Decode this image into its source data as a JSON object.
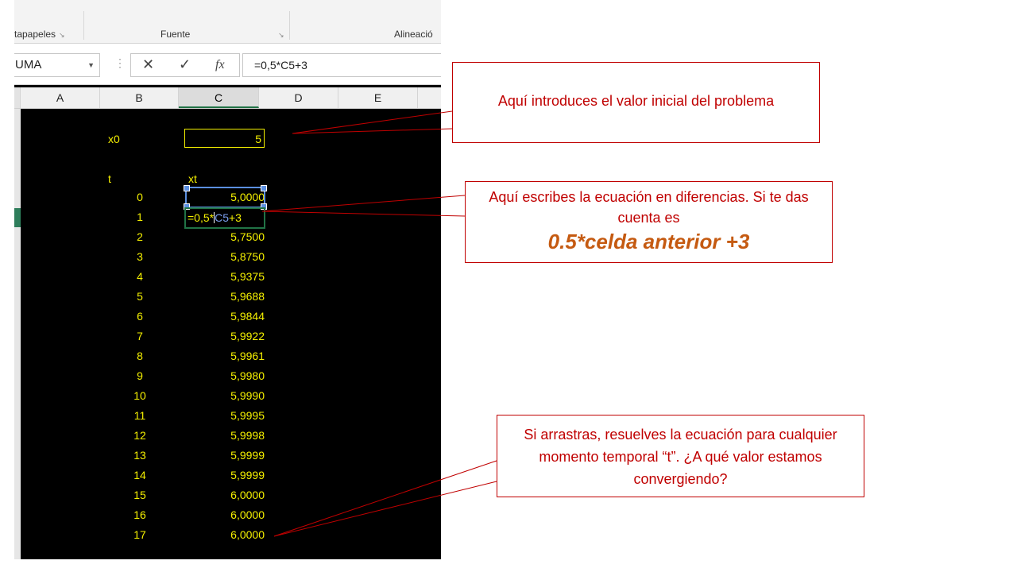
{
  "ribbon": {
    "groups": [
      {
        "label": "tapapeles",
        "launcher": "↘"
      },
      {
        "label": "Fuente",
        "launcher": "↘"
      },
      {
        "label": "Alineació"
      }
    ]
  },
  "formula_bar": {
    "name_box": "UMA",
    "cancel_icon": "✕",
    "enter_icon": "✓",
    "fx_label": "fx",
    "formula": "=0,5*C5+3"
  },
  "columns": [
    "A",
    "B",
    "C",
    "D",
    "E"
  ],
  "sheet": {
    "x0_label": "x0",
    "x0_value": "5",
    "t_header": "t",
    "xt_header": "xt",
    "editing_prefix": "=0,5*",
    "editing_ref": "C5",
    "editing_suffix": "+3",
    "rows": [
      {
        "t": "0",
        "x": "5,0000"
      },
      {
        "t": "1",
        "x": ""
      },
      {
        "t": "2",
        "x": "5,7500"
      },
      {
        "t": "3",
        "x": "5,8750"
      },
      {
        "t": "4",
        "x": "5,9375"
      },
      {
        "t": "5",
        "x": "5,9688"
      },
      {
        "t": "6",
        "x": "5,9844"
      },
      {
        "t": "7",
        "x": "5,9922"
      },
      {
        "t": "8",
        "x": "5,9961"
      },
      {
        "t": "9",
        "x": "5,9980"
      },
      {
        "t": "10",
        "x": "5,9990"
      },
      {
        "t": "11",
        "x": "5,9995"
      },
      {
        "t": "12",
        "x": "5,9998"
      },
      {
        "t": "13",
        "x": "5,9999"
      },
      {
        "t": "14",
        "x": "5,9999"
      },
      {
        "t": "15",
        "x": "6,0000"
      },
      {
        "t": "16",
        "x": "6,0000"
      },
      {
        "t": "17",
        "x": "6,0000"
      }
    ]
  },
  "callouts": {
    "initial": "Aquí introduces el valor inicial del problema",
    "equation": "Aquí escribes la ecuación en diferencias. Si te das cuenta es",
    "equation_emphasis": "0.5*celda anterior +3",
    "drag": "Si arrastras, resuelves la ecuación para cualquier momento temporal “t”. ¿A qué valor estamos convergiendo?"
  },
  "colors": {
    "cell_text": "#f5f000",
    "callout_border": "#c00000",
    "emphasis": "#c55a11",
    "selection": "#217346",
    "reference": "#5b8fe0"
  }
}
